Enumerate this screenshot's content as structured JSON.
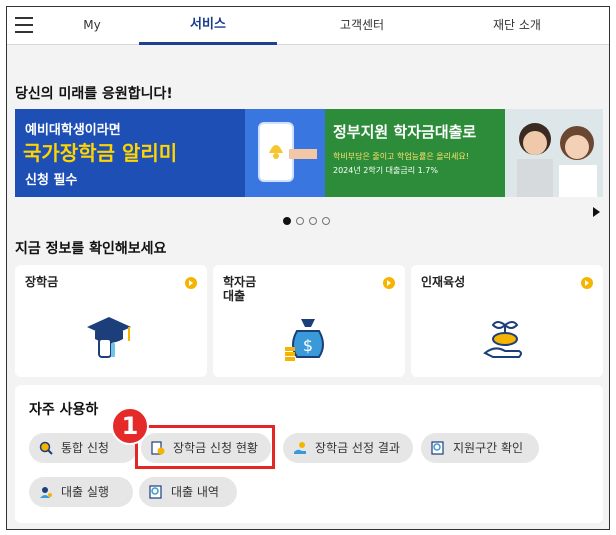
{
  "nav": {
    "tabs": [
      {
        "label": "My"
      },
      {
        "label": "서비스"
      },
      {
        "label": "고객센터"
      },
      {
        "label": "재단 소개"
      }
    ],
    "active_tab": "서비스"
  },
  "hero": {
    "title": "당신의 미래를 응원합니다!",
    "banner": {
      "left_line1": "예비대학생이라면",
      "left_line2": "국가장학금 알리미",
      "left_line3": "신청 필수",
      "right_line1": "정부지원 학자금대출로",
      "right_line2": "학비부담은 줄이고 학업능률은 올리세요!",
      "right_line3": "2024년 2학기 대출금리 1.7%"
    },
    "carousel": {
      "total": 4,
      "active": 1
    }
  },
  "info": {
    "title": "지금 정보를 확인해보세요",
    "cards": [
      {
        "label": "장학금",
        "icon": "graduation-cap-hand-icon"
      },
      {
        "label": "학자금\n대출",
        "icon": "money-bag-icon"
      },
      {
        "label": "인재육성",
        "icon": "sprout-hand-icon"
      }
    ]
  },
  "shortcuts": {
    "title": "자주 사용하",
    "items": [
      {
        "label": "통합 신청",
        "icon": "search-gear-icon"
      },
      {
        "label": "장학금 신청 현황",
        "icon": "document-coin-icon"
      },
      {
        "label": "장학금 선정 결과",
        "icon": "hand-coins-icon"
      },
      {
        "label": "지원구간 확인",
        "icon": "document-search-icon"
      },
      {
        "label": "대출 실행",
        "icon": "person-search-icon"
      },
      {
        "label": "대출 내역",
        "icon": "document-search-icon"
      }
    ]
  },
  "annotation": {
    "step_number": "1"
  },
  "colors": {
    "accent": "#1f3f8f",
    "arrow": "#f5b400",
    "highlight": "#e32626"
  }
}
